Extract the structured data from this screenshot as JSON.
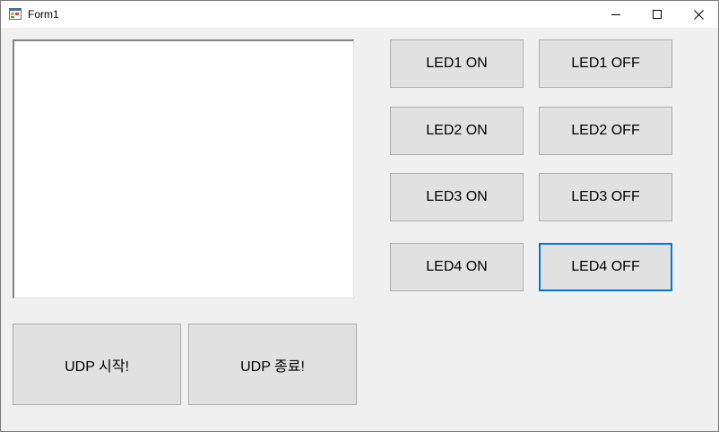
{
  "window": {
    "title": "Form1"
  },
  "caption_buttons": {
    "minimize_icon": "minimize-icon",
    "maximize_icon": "maximize-icon",
    "close_icon": "close-icon"
  },
  "log_box": {
    "value": ""
  },
  "led_buttons": [
    {
      "on_label": "LED1 ON",
      "off_label": "LED1 OFF"
    },
    {
      "on_label": "LED2 ON",
      "off_label": "LED2 OFF"
    },
    {
      "on_label": "LED3 ON",
      "off_label": "LED3 OFF"
    },
    {
      "on_label": "LED4 ON",
      "off_label": "LED4 OFF"
    }
  ],
  "udp": {
    "start_label": "UDP 시작!",
    "stop_label": "UDP 종료!"
  },
  "colors": {
    "focus_border": "#0078d7",
    "button_face": "#e1e1e1",
    "form_background": "#f0f0f0"
  }
}
